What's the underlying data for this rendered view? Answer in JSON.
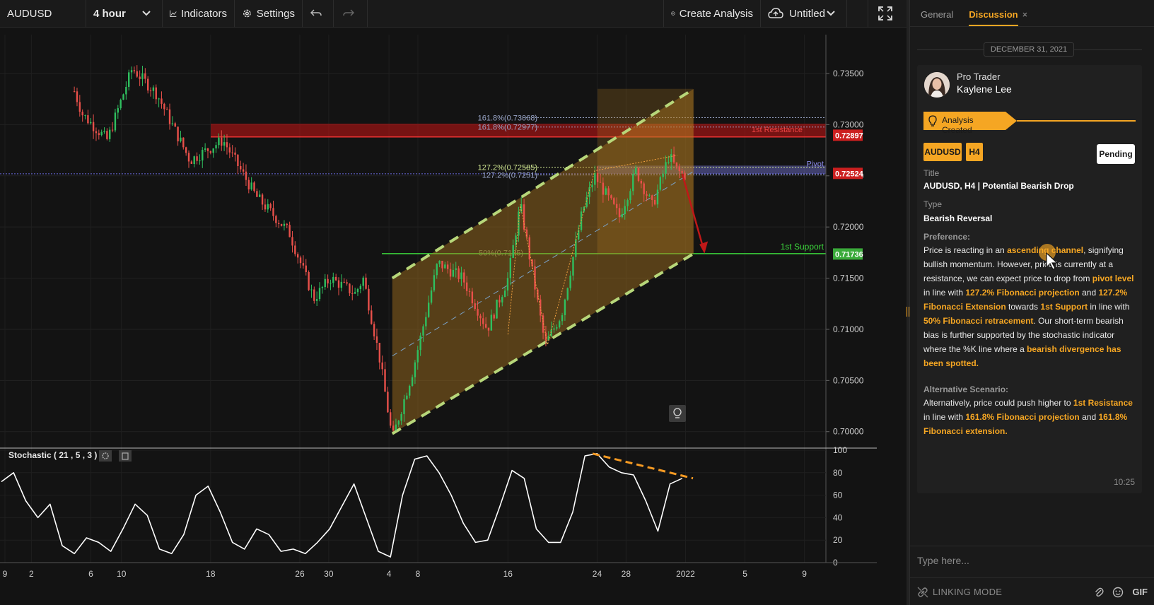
{
  "toolbar": {
    "symbol": "AUDUSD",
    "interval": "4 hour",
    "indicators_label": "Indicators",
    "settings_label": "Settings",
    "create_analysis_label": "Create Analysis",
    "layout_name": "Untitled"
  },
  "chart_data": {
    "type": "candlestick",
    "symbol": "AUDUSD",
    "timeframe": "4 hour",
    "ylim": [
      0.6986,
      0.7388
    ],
    "y_ticks": [
      "0.73500",
      "0.73000",
      "0.72500",
      "0.72000",
      "0.71500",
      "0.71000",
      "0.70500",
      "0.70000"
    ],
    "x_ticks": [
      "9",
      "2",
      "6",
      "10",
      "18",
      "26",
      "30",
      "4",
      "8",
      "16",
      "24",
      "28",
      "2022",
      "5",
      "9"
    ],
    "price_path": [
      {
        "t": 0.0,
        "p": 0.738
      },
      {
        "t": 0.03,
        "p": 0.7385
      },
      {
        "t": 0.07,
        "p": 0.7378
      },
      {
        "t": 0.1,
        "p": 0.731
      },
      {
        "t": 0.13,
        "p": 0.7285
      },
      {
        "t": 0.16,
        "p": 0.7355
      },
      {
        "t": 0.19,
        "p": 0.733
      },
      {
        "t": 0.23,
        "p": 0.7265
      },
      {
        "t": 0.27,
        "p": 0.7285
      },
      {
        "t": 0.31,
        "p": 0.723
      },
      {
        "t": 0.35,
        "p": 0.7195
      },
      {
        "t": 0.38,
        "p": 0.713
      },
      {
        "t": 0.4,
        "p": 0.715
      },
      {
        "t": 0.43,
        "p": 0.7135
      },
      {
        "t": 0.44,
        "p": 0.715
      },
      {
        "t": 0.46,
        "p": 0.707
      },
      {
        "t": 0.475,
        "p": 0.6993
      },
      {
        "t": 0.5,
        "p": 0.706
      },
      {
        "t": 0.53,
        "p": 0.7165
      },
      {
        "t": 0.56,
        "p": 0.715
      },
      {
        "t": 0.59,
        "p": 0.71
      },
      {
        "t": 0.615,
        "p": 0.715
      },
      {
        "t": 0.63,
        "p": 0.7222
      },
      {
        "t": 0.66,
        "p": 0.7085
      },
      {
        "t": 0.68,
        "p": 0.7115
      },
      {
        "t": 0.705,
        "p": 0.7215
      },
      {
        "t": 0.72,
        "p": 0.725
      },
      {
        "t": 0.75,
        "p": 0.721
      },
      {
        "t": 0.77,
        "p": 0.7255
      },
      {
        "t": 0.79,
        "p": 0.722
      },
      {
        "t": 0.81,
        "p": 0.727
      },
      {
        "t": 0.82,
        "p": 0.7255
      },
      {
        "t": 0.83,
        "p": 0.725
      }
    ],
    "levels": [
      {
        "label": "161.8%(0.73068)",
        "price": 0.73068,
        "color": "#9aa6c8"
      },
      {
        "label": "161.8%(0.72977)",
        "price": 0.72977,
        "color": "#9aa6c8"
      },
      {
        "label": "127.2%(0.72585)",
        "price": 0.72585,
        "color": "#cde38f"
      },
      {
        "label": "127.2%(0.7251)",
        "price": 0.7251,
        "color": "#9aa6c8"
      },
      {
        "label": "50%(0.7175)",
        "price": 0.7175,
        "color": "#7a8d5e"
      }
    ],
    "resistance_zone": {
      "label": "1st Resistance",
      "top": 0.7301,
      "bottom": 0.7288,
      "price_tag": "0.72897"
    },
    "pivot_zone": {
      "label": "Pivot",
      "top": 0.726,
      "bottom": 0.7252,
      "price_tag": "0.72524"
    },
    "support": {
      "label": "1st Support",
      "price": 0.7174,
      "price_tag": "0.71736"
    },
    "channel": {
      "upper": [
        {
          "t": 0.475,
          "p": 0.715
        },
        {
          "t": 0.84,
          "p": 0.7335
        }
      ],
      "lower": [
        {
          "t": 0.475,
          "p": 0.6998
        },
        {
          "t": 0.84,
          "p": 0.7174
        }
      ]
    },
    "stochastic": {
      "title": "Stochastic ( 21 , 5 , 3 )",
      "ylim": [
        0,
        100
      ],
      "y_ticks": [
        "100",
        "80",
        "60",
        "40",
        "20",
        "0"
      ],
      "k": [
        72,
        80,
        55,
        40,
        52,
        15,
        8,
        22,
        18,
        10,
        30,
        52,
        42,
        12,
        8,
        25,
        60,
        68,
        45,
        18,
        12,
        30,
        25,
        10,
        12,
        8,
        18,
        30,
        50,
        70,
        40,
        10,
        5,
        60,
        92,
        95,
        80,
        60,
        35,
        18,
        20,
        50,
        82,
        75,
        30,
        18,
        18,
        45,
        95,
        97,
        85,
        80,
        78,
        55,
        28,
        70,
        75
      ]
    }
  },
  "panel": {
    "tabs": {
      "general": "General",
      "discussion": "Discussion",
      "close_glyph": "×"
    },
    "date": "DECEMBER 31, 2021",
    "author": {
      "role": "Pro Trader",
      "name": "Kaylene Lee"
    },
    "status_banner": "Analysis Created",
    "tags": {
      "symbol": "AUDUSD",
      "timeframe": "H4"
    },
    "pending": "Pending",
    "title_label": "Title",
    "title_value": "AUDUSD, H4 | Potential Bearish Drop",
    "type_label": "Type",
    "type_value": "Bearish Reversal",
    "preference_label": "Preference:",
    "preference": [
      {
        "t": "Price is reacting in an "
      },
      {
        "t": "ascending channel",
        "h": true
      },
      {
        "t": ", signifying bullish momentum. However, price is currently at a resistance, we can expect price to drop from "
      },
      {
        "t": "pivot level",
        "h": true
      },
      {
        "t": " in line with "
      },
      {
        "t": "127.2% Fibonacci projection",
        "h": true
      },
      {
        "t": " and "
      },
      {
        "t": "127.2% Fibonacci Extension",
        "h": true
      },
      {
        "t": " towards "
      },
      {
        "t": "1st Support",
        "h": true
      },
      {
        "t": " in line with "
      },
      {
        "t": "50% Fibonacci retracement",
        "h": true
      },
      {
        "t": ". Our short-term bearish bias is further supported by the stochastic indicator where the %K line where a "
      },
      {
        "t": "bearish divergence has been spotted.",
        "h": true
      }
    ],
    "alt_label": "Alternative Scenario:",
    "alternative": [
      {
        "t": "Alternatively, price could push higher to "
      },
      {
        "t": "1st Resistance",
        "h": true
      },
      {
        "t": " in line with "
      },
      {
        "t": "161.8% Fibonacci projection",
        "h": true
      },
      {
        "t": " and "
      },
      {
        "t": "161.8% Fibonacci extension.",
        "h": true
      }
    ],
    "time": "10:25",
    "message_placeholder": "Type here...",
    "linking_mode": "LINKING MODE",
    "gif_label": "GIF"
  }
}
